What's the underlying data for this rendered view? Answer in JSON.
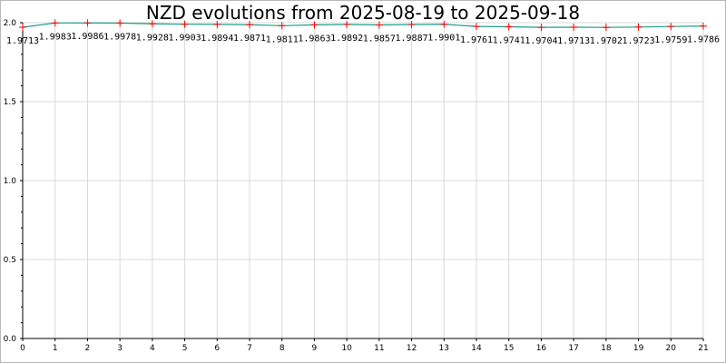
{
  "chart_data": {
    "type": "line",
    "title": "NZD evolutions from 2025-08-19 to 2025-09-18",
    "xlabel": "",
    "ylabel": "",
    "x": [
      0,
      1,
      2,
      3,
      4,
      5,
      6,
      7,
      8,
      9,
      10,
      11,
      12,
      13,
      14,
      15,
      16,
      17,
      18,
      19,
      20,
      21
    ],
    "values": [
      1.9713,
      1.9983,
      1.9986,
      1.9978,
      1.9928,
      1.9903,
      1.9894,
      1.9871,
      1.9811,
      1.9863,
      1.9892,
      1.9857,
      1.9887,
      1.9901,
      1.9761,
      1.9741,
      1.9704,
      1.9713,
      1.9702,
      1.9723,
      1.9759,
      1.9786
    ],
    "labels": [
      "1.9713",
      "1.9983",
      "1.9986",
      "1.9978",
      "1.9928",
      "1.9903",
      "1.9894",
      "1.9871",
      "1.9811",
      "1.9863",
      "1.9892",
      "1.9857",
      "1.9887",
      "1.9901",
      "1.9761",
      "1.9741",
      "1.9704",
      "1.9713",
      "1.9702",
      "1.9723",
      "1.9759",
      "1.9786"
    ],
    "xlim": [
      0,
      21
    ],
    "ylim": [
      0,
      2.0
    ],
    "xticks": [
      "0",
      "1",
      "2",
      "3",
      "4",
      "5",
      "6",
      "7",
      "8",
      "9",
      "10",
      "11",
      "12",
      "13",
      "14",
      "15",
      "16",
      "17",
      "18",
      "19",
      "20",
      "21"
    ],
    "yticks": [
      "0.0",
      "0.5",
      "1.0",
      "1.5",
      "2.0"
    ],
    "grid": true,
    "line_color": "#1a9e8a",
    "marker_color": "#ff0000",
    "grid_color": "#d9d9d9"
  }
}
